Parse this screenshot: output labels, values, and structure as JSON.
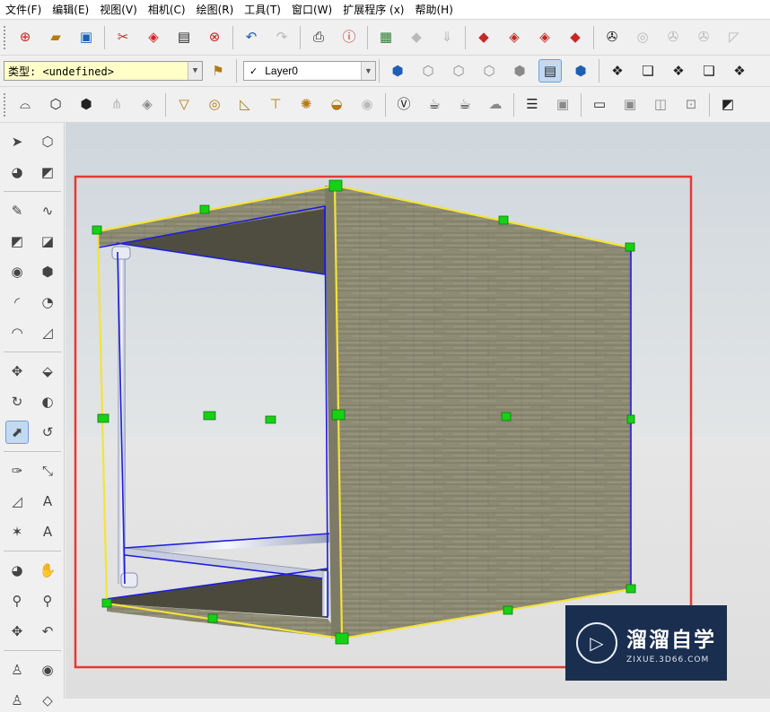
{
  "menu": [
    "文件(F)",
    "编辑(E)",
    "视图(V)",
    "相机(C)",
    "绘图(R)",
    "工具(T)",
    "窗口(W)",
    "扩展程序 (x)",
    "帮助(H)"
  ],
  "entity_info": {
    "type_value": "类型: <undefined>",
    "layer_value": "Layer0",
    "layer_checkmark": "✓"
  },
  "watermark": {
    "brand": "溜溜自学",
    "site": "ZIXUE.3D66.COM"
  },
  "icons": {
    "toolbar1": [
      "add-model-icon",
      "open-folder-icon",
      "save-icon",
      "cut-icon",
      "paste-icon",
      "clipboard-icon",
      "erase-icon",
      "undo-icon",
      "redo-icon",
      "print-icon",
      "model-info-icon",
      "geolocation-icon",
      "terrain-icon",
      "sandbox-icon",
      "warehouse-icon",
      "get-models-icon",
      "share-model-icon",
      "extension-warehouse-icon",
      "section-plane-icon",
      "display-sections-icon",
      "section-cuts-icon",
      "section-fill-icon",
      "walk-icon"
    ],
    "toolbar2": [
      "x-ray-icon",
      "back-edges-icon",
      "wireframe-icon",
      "hidden-line-icon",
      "shaded-icon",
      "shaded-textures-icon",
      "monochrome-icon",
      "union-icon",
      "subtract-icon",
      "trim-icon",
      "intersect-icon",
      "split-icon"
    ],
    "toolbar3": [
      "position-camera-icon",
      "component-icon",
      "group-icon",
      "texture-grass-icon",
      "tag-icon",
      "cone-icon",
      "circle-target-icon",
      "roof-icon",
      "walkthrough-icon",
      "sun-icon",
      "dome-icon",
      "target-icon",
      "vray-icon",
      "render-teapot-icon",
      "interactive-render-icon",
      "cloud-render-icon",
      "lights-icon",
      "frame-buffer-icon",
      "dock-icon",
      "material-icon",
      "sphere-light-icon",
      "lock-icon",
      "eraser-icon"
    ],
    "sidebar": [
      "select-icon",
      "make-component-icon",
      "paint-bucket-icon",
      "eraser-icon",
      "pencil-icon",
      "freehand-icon",
      "rectangle-icon",
      "rotated-rectangle-icon",
      "circle-icon",
      "polygon-icon",
      "arc-icon",
      "pie-icon",
      "3pt-arc-icon",
      "2pt-arc-icon",
      "move-icon",
      "push-pull-icon",
      "rotate-icon",
      "follow-me-icon",
      "scale-icon",
      "offset-icon",
      "tape-measure-icon",
      "dimension-icon",
      "protractor-icon",
      "text-icon",
      "axes-icon",
      "3d-text-icon",
      "orbit-icon",
      "pan-icon",
      "zoom-icon",
      "zoom-window-icon",
      "zoom-extents-icon",
      "previous-view-icon",
      "position-camera-icon",
      "look-around-icon",
      "walk-icon",
      "section-plane-icon"
    ]
  },
  "colors": {
    "selection_box": "#e53935",
    "bounding_box": "#f3e33b",
    "selected_edges": "#1e1edc",
    "grip_handles": "#16d116"
  }
}
